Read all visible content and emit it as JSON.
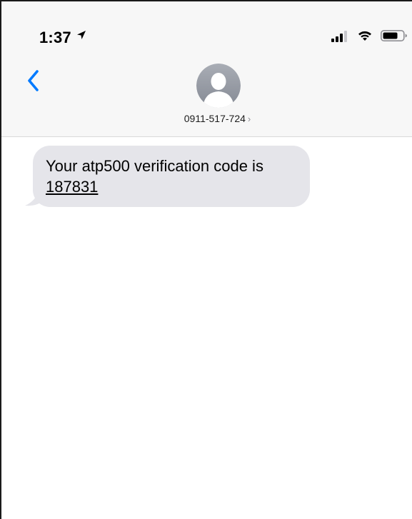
{
  "status_bar": {
    "time": "1:37",
    "icons": [
      "location-arrow-icon",
      "cellular-signal-icon",
      "wifi-icon",
      "battery-icon"
    ]
  },
  "nav": {
    "back_icon": "chevron-left-icon",
    "avatar_icon": "person-silhouette-icon",
    "contact_number": "0911-517-724",
    "contact_chevron": "›"
  },
  "messages": [
    {
      "direction": "incoming",
      "text_before_code": "Your atp500 verification code is ",
      "code": "187831"
    }
  ],
  "colors": {
    "accent": "#007aff",
    "incoming_bubble": "#e5e5ea",
    "header_background": "#f7f7f7",
    "avatar": "#a5a9b1"
  }
}
